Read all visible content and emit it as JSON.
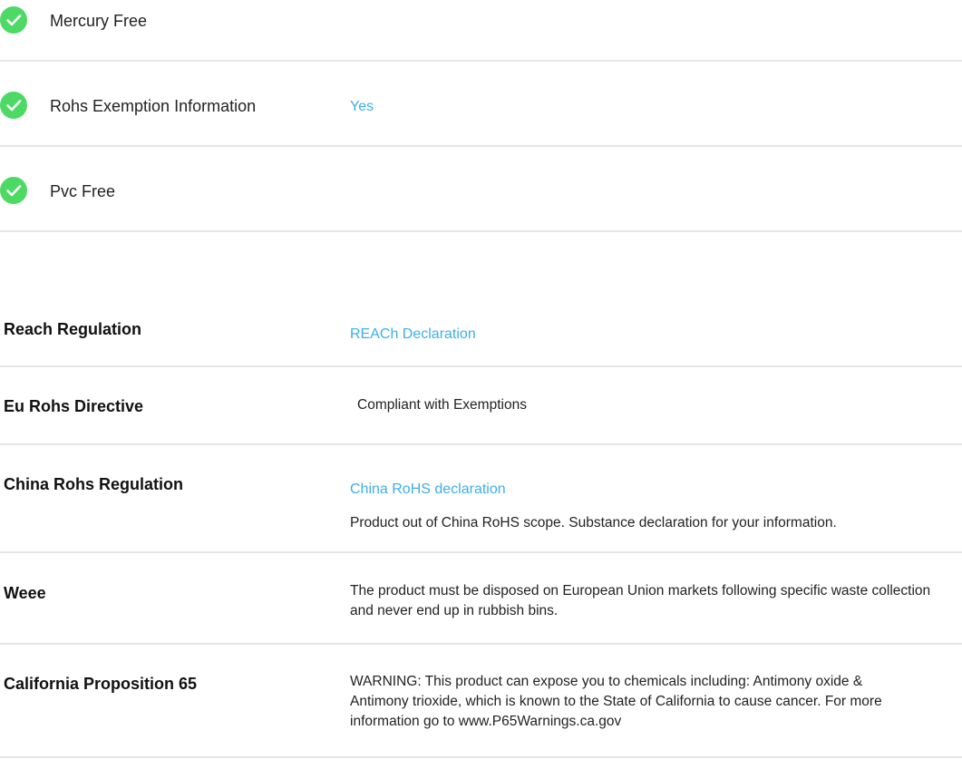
{
  "features": [
    {
      "label": "Mercury Free",
      "value": "",
      "icon": "check-circle-icon"
    },
    {
      "label": "Rohs Exemption Information",
      "value": "Yes",
      "icon": "check-circle-icon"
    },
    {
      "label": "Pvc Free",
      "value": "",
      "icon": "check-circle-icon"
    }
  ],
  "regulations": {
    "reach": {
      "label": "Reach Regulation",
      "link": "REACh Declaration"
    },
    "eu_rohs": {
      "label": "Eu Rohs Directive",
      "text": "Compliant with Exemptions"
    },
    "china_rohs": {
      "label": "China Rohs Regulation",
      "link": "China RoHS declaration",
      "text": "Product out of China RoHS scope. Substance declaration for your information."
    },
    "weee": {
      "label": "Weee",
      "text": "The product must be disposed on European Union markets following specific waste collection and never end up in rubbish bins."
    },
    "prop65": {
      "label": "California Proposition 65",
      "text": "WARNING: This product can expose you to chemicals including: Antimony oxide & Antimony trioxide, which is known to the State of California to cause cancer. For more information go to www.P65Warnings.ca.gov"
    }
  },
  "colors": {
    "check": "#4cd964",
    "link": "#3daee9",
    "divider": "#e6e6e6",
    "text": "#222222"
  }
}
